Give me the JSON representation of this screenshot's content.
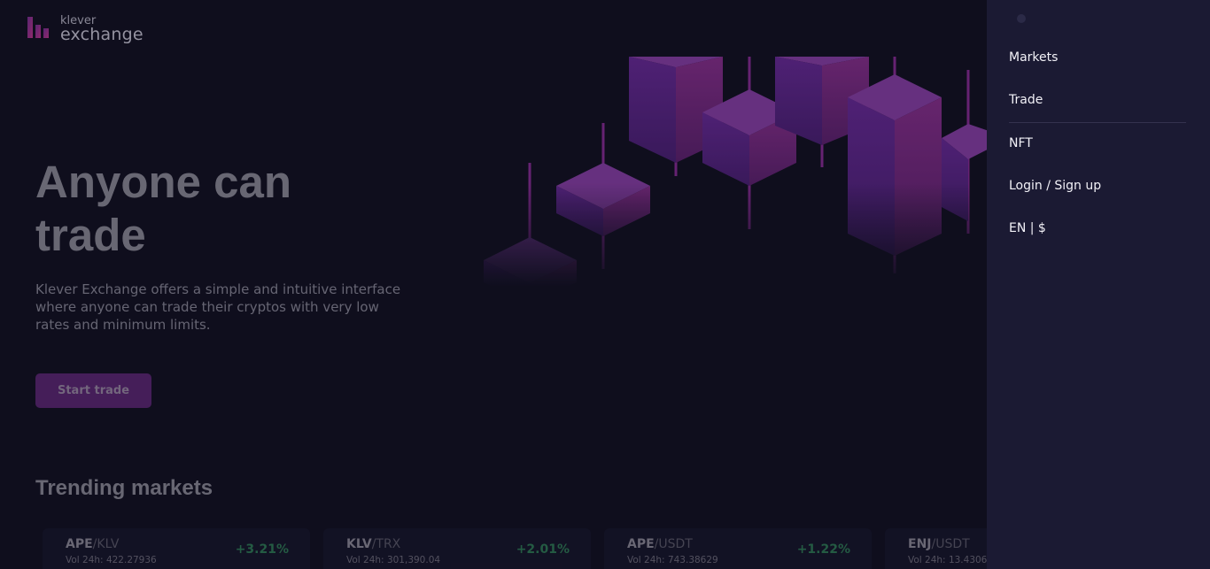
{
  "logo": {
    "top": "klever",
    "bottom": "exchange"
  },
  "hero": {
    "title_line1": "Anyone can",
    "title_line2": "trade",
    "description": "Klever Exchange offers a simple and intuitive interface where anyone can trade their cryptos with very low rates and minimum limits.",
    "cta": "Start trade"
  },
  "trending": {
    "title": "Trending markets",
    "cards": [
      {
        "base": "APE",
        "quote": "/KLV",
        "volume": "Vol 24h: 422.27936",
        "change": "+3.21%"
      },
      {
        "base": "KLV",
        "quote": "/TRX",
        "volume": "Vol 24h: 301,390.04",
        "change": "+2.01%"
      },
      {
        "base": "APE",
        "quote": "/USDT",
        "volume": "Vol 24h: 743.38629",
        "change": "+1.22%"
      },
      {
        "base": "ENJ",
        "quote": "/USDT",
        "volume": "Vol 24h: 13.43060",
        "change": ""
      }
    ]
  },
  "drawer": {
    "items": [
      "Markets",
      "Trade",
      "NFT",
      "Login / Sign up",
      "EN | $"
    ]
  },
  "colors": {
    "background": "#111021",
    "drawer": "#1b1a33",
    "accent": "#5c2673",
    "positive": "#2f7a55"
  }
}
